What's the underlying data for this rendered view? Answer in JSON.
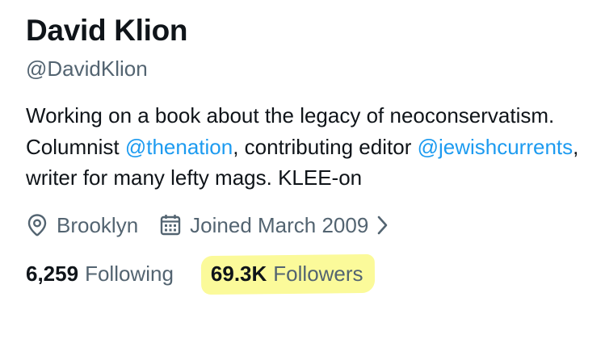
{
  "profile": {
    "display_name": "David Klion",
    "handle": "@DavidKlion",
    "bio": {
      "text1": "Working on a book about the legacy of neoconservatism. Columnist ",
      "mention1": "@thenation",
      "text2": ", contributing editor ",
      "mention2": "@jewishcurrents",
      "text3": ", writer for many lefty mags. KLEE-on"
    },
    "location": "Brooklyn",
    "joined": "Joined March 2009",
    "following_count": "6,259",
    "following_label": "Following",
    "followers_count": "69.3K",
    "followers_label": "Followers"
  },
  "icons": {
    "location": "location-pin-icon",
    "calendar": "calendar-icon",
    "chevron": "chevron-right-icon"
  },
  "colors": {
    "text": "#0f1419",
    "secondary": "#536471",
    "link": "#1d9bf0",
    "highlight": "#fbfa9a"
  }
}
